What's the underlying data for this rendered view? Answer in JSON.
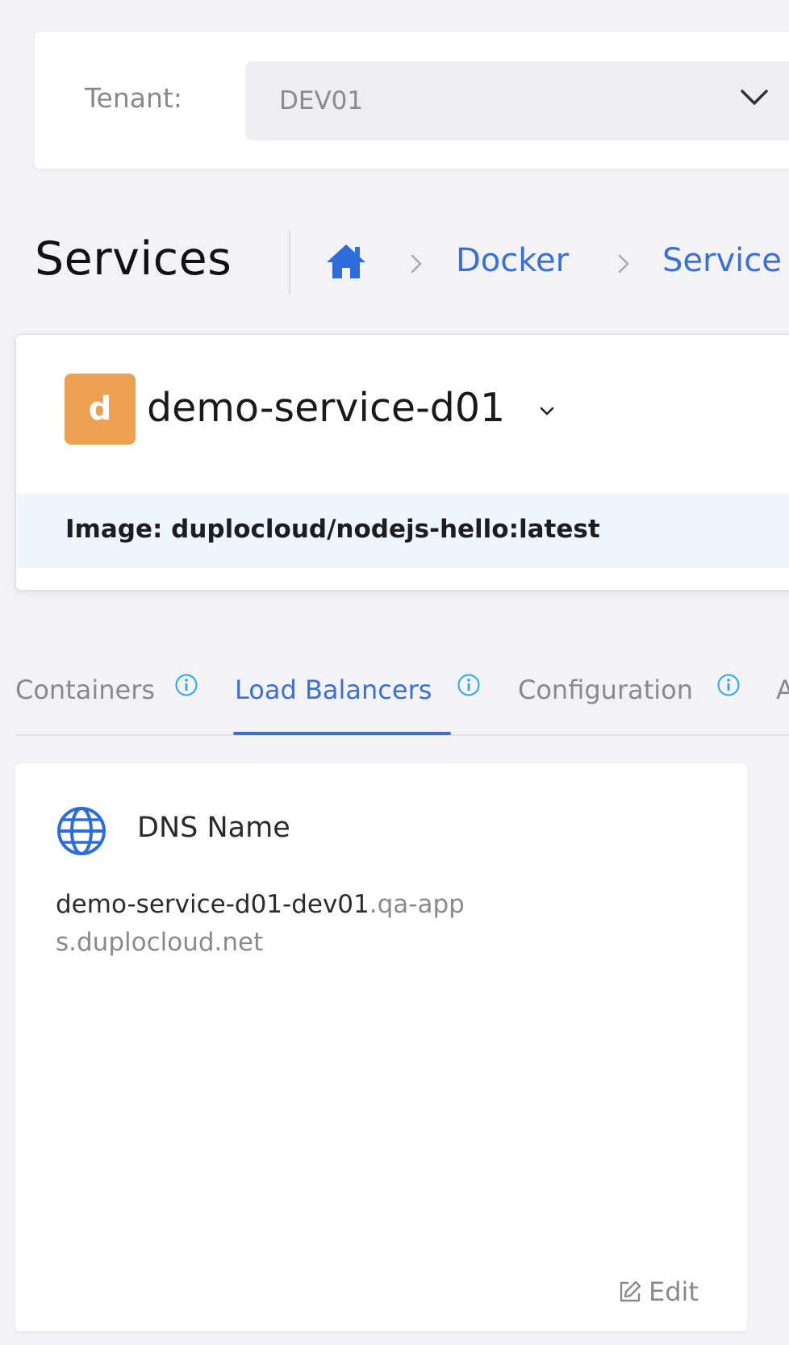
{
  "tenant": {
    "label": "Tenant:",
    "value": "DEV01"
  },
  "header": {
    "title": "Services",
    "breadcrumb": [
      "Docker",
      "Service"
    ]
  },
  "service": {
    "avatar_letter": "d",
    "avatar_color": "#eea052",
    "name": "demo-service-d01",
    "image": "Image: duplocloud/nodejs-hello:latest"
  },
  "tabs": [
    {
      "label": "Containers",
      "active": false
    },
    {
      "label": "Load Balancers",
      "active": true
    },
    {
      "label": "Configuration",
      "active": false
    },
    {
      "label": "A",
      "active": false
    }
  ],
  "dns": {
    "title": "DNS Name",
    "value_main": "demo-service-d01-dev01",
    "value_suffix": ".qa-apps.duplocloud.net",
    "edit_label": "Edit"
  },
  "colors": {
    "accent": "#3a6fd8",
    "info": "#2aa4f4",
    "image_strip": "#eef5fd"
  },
  "icons": [
    "chevron-down-icon",
    "home-icon",
    "chevron-right-icon",
    "caret-down-icon",
    "info-icon",
    "globe-icon",
    "edit-icon"
  ]
}
